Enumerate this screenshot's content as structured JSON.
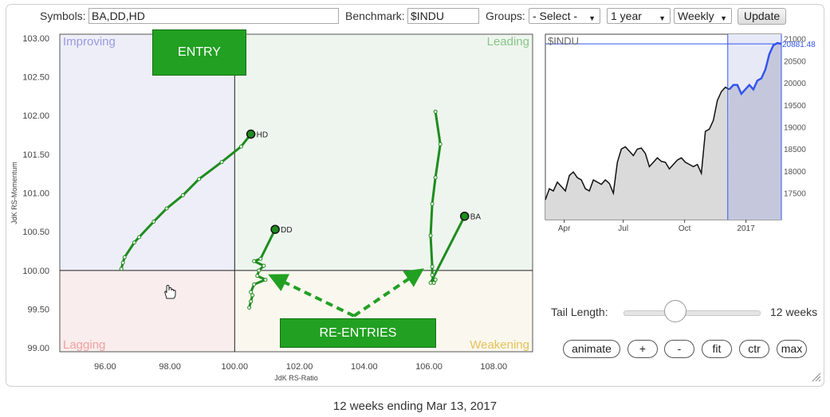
{
  "toolbar": {
    "symbols_label": "Symbols:",
    "symbols_value": "BA,DD,HD",
    "benchmark_label": "Benchmark:",
    "benchmark_value": "$INDU",
    "groups_label": "Groups:",
    "groups_value": "- Select -",
    "period_value": "1 year",
    "interval_value": "Weekly",
    "update_label": "Update"
  },
  "colors": {
    "improving": "#eeeef8",
    "leading": "#eef5ee",
    "lagging": "#f9eded",
    "weakening": "#faf8ee",
    "tail": "#1e8c1e",
    "annotation": "#22a022",
    "price_line": "#111111",
    "price_highlight": "#3355ee"
  },
  "annotations": {
    "entry": "ENTRY",
    "reentries": "RE-ENTRIES"
  },
  "chart_data": [
    {
      "type": "scatter",
      "xlabel": "JdK RS-Ratio",
      "ylabel": "JdK RS-Momentum",
      "xlim": [
        94.6,
        109.2
      ],
      "ylim": [
        98.95,
        103.05
      ],
      "xticks": [
        "96.00",
        "98.00",
        "100.00",
        "102.00",
        "104.00",
        "106.00",
        "108.00"
      ],
      "yticks": [
        "103.00",
        "102.50",
        "102.00",
        "101.50",
        "101.00",
        "100.50",
        "100.00",
        "99.50",
        "99.00"
      ],
      "quadrants": {
        "improving": "Improving",
        "leading": "Leading",
        "lagging": "Lagging",
        "weakening": "Weakening"
      },
      "series": [
        {
          "name": "HD",
          "x": [
            96.5,
            96.55,
            96.6,
            96.9,
            97.05,
            97.5,
            97.9,
            98.4,
            98.9,
            99.6,
            100.2,
            100.5
          ],
          "y": [
            100.02,
            100.1,
            100.17,
            100.36,
            100.43,
            100.63,
            100.8,
            100.97,
            101.18,
            101.4,
            101.6,
            101.76
          ]
        },
        {
          "name": "DD",
          "x": [
            100.45,
            100.5,
            100.55,
            100.5,
            100.6,
            100.95,
            100.7,
            100.75,
            100.9,
            100.6,
            100.8,
            101.25
          ],
          "y": [
            99.52,
            99.6,
            99.68,
            99.72,
            99.82,
            99.88,
            99.93,
            100.0,
            100.06,
            100.12,
            100.15,
            100.53
          ]
        },
        {
          "name": "BA",
          "x": [
            106.2,
            106.35,
            106.2,
            106.1,
            106.05,
            106.1,
            106.1,
            106.15,
            106.15,
            106.2,
            106.05,
            107.1
          ],
          "y": [
            102.05,
            101.63,
            101.2,
            100.86,
            100.45,
            100.05,
            99.94,
            99.84,
            99.84,
            99.88,
            99.84,
            100.7
          ]
        }
      ]
    },
    {
      "type": "line",
      "title": "$INDU",
      "x": [
        "Apr",
        "Jul",
        "Oct",
        "2017"
      ],
      "ylim": [
        16900,
        21100
      ],
      "yticks": [
        "21000",
        "20500",
        "20000",
        "19500",
        "19000",
        "18500",
        "18000",
        "17500"
      ],
      "last_value": "20881.48",
      "values": [
        17350,
        17600,
        17550,
        17750,
        17650,
        17550,
        17900,
        17980,
        17850,
        17800,
        17600,
        17550,
        17800,
        17750,
        17700,
        17800,
        17720,
        17500,
        18200,
        18500,
        18550,
        18450,
        18350,
        18500,
        18520,
        18400,
        18100,
        18200,
        18300,
        18220,
        18200,
        18050,
        18150,
        18250,
        18300,
        18200,
        18150,
        18100,
        18150,
        17950,
        18900,
        18950,
        19150,
        19600,
        19800,
        19900,
        19850,
        19950,
        19950,
        19750,
        19850,
        19950,
        19850,
        20050,
        20100,
        20300,
        20650,
        20850,
        20900,
        20881
      ]
    }
  ],
  "controls": {
    "tail_label": "Tail Length:",
    "tail_value": "12 weeks",
    "tail_fraction": 0.38,
    "buttons": [
      "animate",
      "+",
      "-",
      "fit",
      "ctr",
      "max"
    ]
  },
  "caption": "12 weeks ending Mar 13, 2017"
}
